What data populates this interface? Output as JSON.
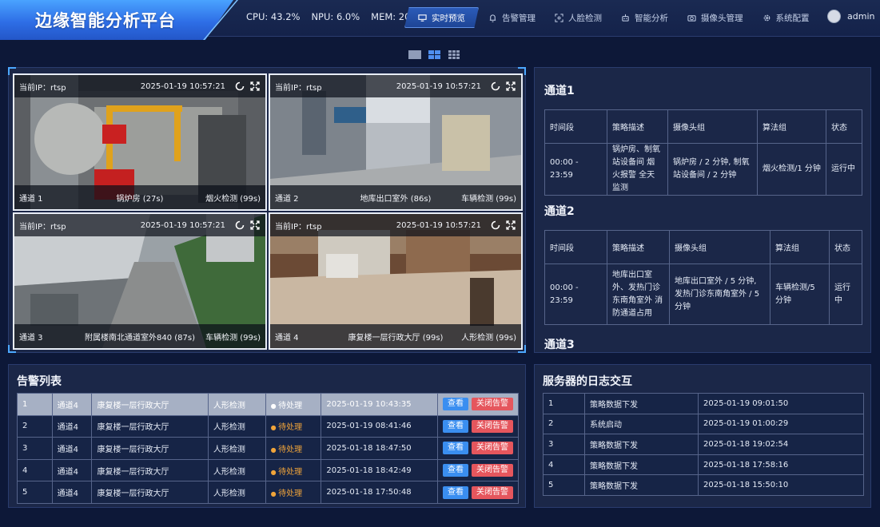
{
  "app": {
    "title": "边缘智能分析平台"
  },
  "metrics": {
    "cpu": "CPU: 43.2%",
    "npu": "NPU: 6.0%",
    "mem": "MEM: 20.28%"
  },
  "nav": {
    "items": [
      {
        "label": "实时预览",
        "icon": "monitor-icon"
      },
      {
        "label": "告警管理",
        "icon": "bell-icon"
      },
      {
        "label": "人脸检测",
        "icon": "face-scan-icon"
      },
      {
        "label": "智能分析",
        "icon": "robot-icon"
      },
      {
        "label": "摄像头管理",
        "icon": "camera-icon"
      },
      {
        "label": "系统配置",
        "icon": "gear-icon"
      }
    ],
    "active": "实时预览"
  },
  "user": {
    "name": "admin"
  },
  "layout_options": [
    "single",
    "quad",
    "nine"
  ],
  "cameras": [
    {
      "ip": "当前IP：rtsp",
      "time": "2025-01-19 10:57:21",
      "channel": "通道 1",
      "place": "锅炉房 (27s)",
      "algo": "烟火检测 (99s)"
    },
    {
      "ip": "当前IP：rtsp",
      "time": "2025-01-19 10:57:21",
      "channel": "通道 2",
      "place": "地库出口室外 (86s)",
      "algo": "车辆检测 (99s)"
    },
    {
      "ip": "当前IP：rtsp",
      "time": "2025-01-19 10:57:21",
      "channel": "通道 3",
      "place": "附属楼南北通道室外840 (87s)",
      "algo": "车辆检测 (99s)"
    },
    {
      "ip": "当前IP：rtsp",
      "time": "2025-01-19 10:57:21",
      "channel": "通道 4",
      "place": "康复楼一层行政大厅 (99s)",
      "algo": "人形检测 (99s)"
    }
  ],
  "channels": {
    "headers": [
      "时间段",
      "策略描述",
      "摄像头组",
      "算法组",
      "状态"
    ],
    "list": [
      {
        "title": "通道1",
        "row": [
          "00:00 - 23:59",
          "锅炉房、制氧站设备间 烟火报警 全天监测",
          "锅炉房 / 2 分钟, 制氧站设备间 / 2 分钟",
          "烟火检测/1 分钟",
          "运行中"
        ]
      },
      {
        "title": "通道2",
        "row": [
          "00:00 - 23:59",
          "地库出口室外、发热门诊东南角室外 消防通道占用",
          "地库出口室外 / 5 分钟, 发热门诊东南角室外 / 5 分钟",
          "车辆检测/5 分钟",
          "运行中"
        ]
      },
      {
        "title": "通道3"
      }
    ]
  },
  "alarms": {
    "title": "告警列表",
    "view_label": "查看",
    "close_label": "关闭告警",
    "rows": [
      [
        "1",
        "通道4",
        "康复楼一层行政大厅",
        "人形检测",
        "待处理",
        "2025-01-19 10:43:35"
      ],
      [
        "2",
        "通道4",
        "康复楼一层行政大厅",
        "人形检测",
        "待处理",
        "2025-01-19 08:41:46"
      ],
      [
        "3",
        "通道4",
        "康复楼一层行政大厅",
        "人形检测",
        "待处理",
        "2025-01-18 18:47:50"
      ],
      [
        "4",
        "通道4",
        "康复楼一层行政大厅",
        "人形检测",
        "待处理",
        "2025-01-18 18:42:49"
      ],
      [
        "5",
        "通道4",
        "康复楼一层行政大厅",
        "人形检测",
        "待处理",
        "2025-01-18 17:50:48"
      ]
    ]
  },
  "logs": {
    "title": "服务器的日志交互",
    "rows": [
      [
        "1",
        "策略数据下发",
        "2025-01-19 09:01:50"
      ],
      [
        "2",
        "系统启动",
        "2025-01-19 01:00:29"
      ],
      [
        "3",
        "策略数据下发",
        "2025-01-18 19:02:54"
      ],
      [
        "4",
        "策略数据下发",
        "2025-01-18 17:58:16"
      ],
      [
        "5",
        "策略数据下发",
        "2025-01-18 15:50:10"
      ]
    ]
  },
  "colors": {
    "accent": "#3a8ef0",
    "danger": "#e5565d",
    "pending": "#f0a43a",
    "background": "#0d1838"
  }
}
